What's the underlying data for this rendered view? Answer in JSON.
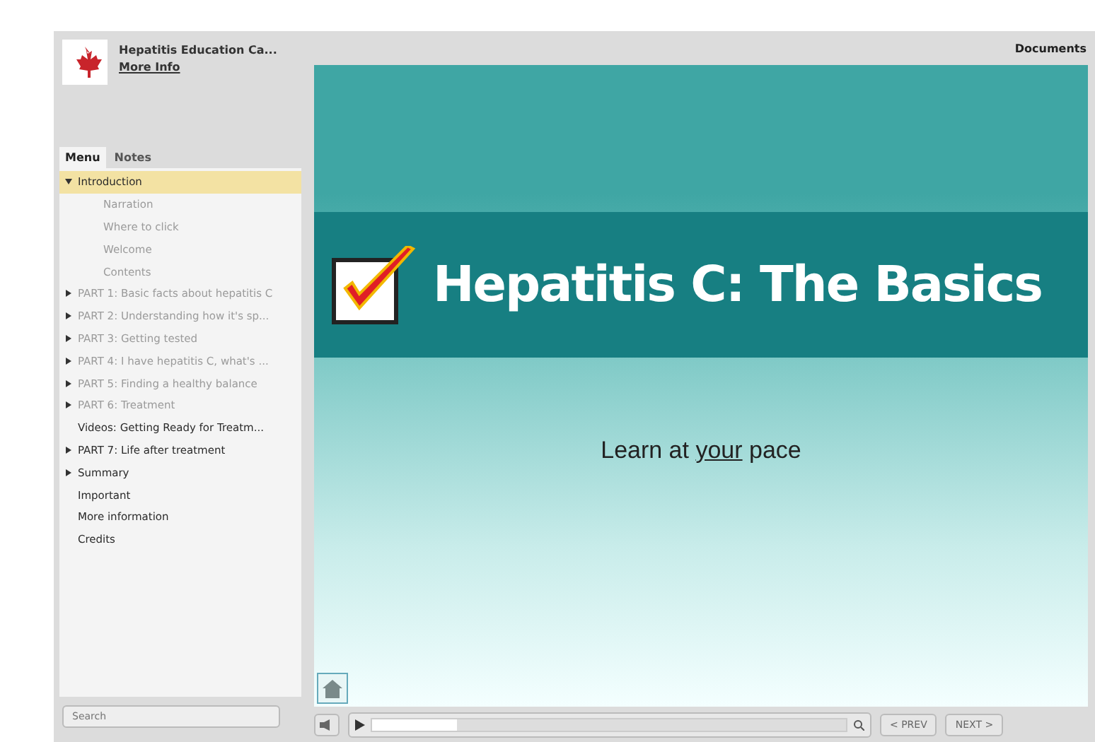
{
  "header": {
    "title": "Hepatitis Education Ca...",
    "link": "More Info"
  },
  "top_bar": {
    "documents": "Documents"
  },
  "tabs": [
    {
      "label": "Menu",
      "selected": true
    },
    {
      "label": "Notes",
      "selected": false
    }
  ],
  "menu": [
    {
      "label": "Introduction",
      "selected": true,
      "dimmed": false,
      "expanded": true,
      "children": [
        {
          "label": "Narration",
          "selected": false,
          "dimmed": true
        },
        {
          "label": "Where to click",
          "selected": false,
          "dimmed": true
        },
        {
          "label": "Welcome",
          "selected": false,
          "dimmed": true
        },
        {
          "label": "Contents",
          "selected": false,
          "dimmed": true
        }
      ]
    },
    {
      "label": "PART 1: Basic facts about hepatitis C",
      "selected": false,
      "dimmed": true,
      "expanded": false
    },
    {
      "label": "PART 2: Understanding how it's sp...",
      "selected": false,
      "dimmed": true,
      "expanded": false
    },
    {
      "label": "PART 3: Getting tested",
      "selected": false,
      "dimmed": true,
      "expanded": false
    },
    {
      "label": "PART 4: I have hepatitis C, what's ...",
      "selected": false,
      "dimmed": true,
      "expanded": false
    },
    {
      "label": "PART 5: Finding a healthy balance",
      "selected": false,
      "dimmed": true,
      "expanded": false
    },
    {
      "label": "PART 6: Treatment",
      "selected": false,
      "dimmed": true,
      "expanded": false
    },
    {
      "label": "Videos: Getting Ready for Treatm...",
      "selected": false,
      "dimmed": false
    },
    {
      "label": "PART 7: Life after treatment",
      "selected": false,
      "dimmed": false,
      "expanded": false
    },
    {
      "label": "Summary",
      "selected": false,
      "dimmed": false,
      "expanded": false
    },
    {
      "label": "Important",
      "selected": false,
      "dimmed": false
    },
    {
      "label": "More information",
      "selected": false,
      "dimmed": false
    },
    {
      "label": "Credits",
      "selected": false,
      "dimmed": false
    }
  ],
  "slide": {
    "title": "Hepatitis C: The Basics",
    "subtitle": "Learn at *your* pace"
  },
  "search": {
    "placeholder": "Search"
  },
  "player": {
    "level": 0.18,
    "prev": "< PREV",
    "next": "NEXT >"
  }
}
